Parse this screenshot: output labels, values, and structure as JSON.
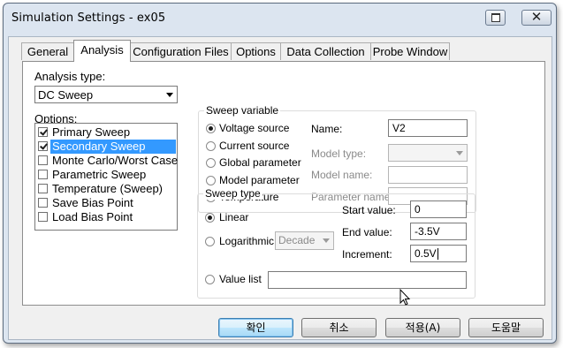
{
  "window": {
    "title": "Simulation Settings - ex05"
  },
  "tabs": [
    "General",
    "Analysis",
    "Configuration Files",
    "Options",
    "Data Collection",
    "Probe Window"
  ],
  "active_tab": "Analysis",
  "analysis": {
    "type_label": "Analysis type:",
    "type_value": "DC Sweep",
    "options_label": "Options:",
    "options": [
      {
        "label": "Primary Sweep",
        "checked": true,
        "selected": false
      },
      {
        "label": "Secondary Sweep",
        "checked": true,
        "selected": true
      },
      {
        "label": "Monte Carlo/Worst Case",
        "checked": false,
        "selected": false
      },
      {
        "label": "Parametric Sweep",
        "checked": false,
        "selected": false
      },
      {
        "label": "Temperature (Sweep)",
        "checked": false,
        "selected": false
      },
      {
        "label": "Save Bias Point",
        "checked": false,
        "selected": false
      },
      {
        "label": "Load Bias Point",
        "checked": false,
        "selected": false
      }
    ]
  },
  "sweep_variable": {
    "title": "Sweep variable",
    "options": [
      "Voltage source",
      "Current source",
      "Global parameter",
      "Model parameter",
      "Temperature"
    ],
    "selected": "Voltage source",
    "name_label": "Name:",
    "name_value": "V2",
    "model_type_label": "Model type:",
    "model_type_value": "",
    "model_name_label": "Model name:",
    "model_name_value": "",
    "parameter_name_label": "Parameter name:",
    "parameter_name_value": ""
  },
  "sweep_type": {
    "title": "Sweep type",
    "linear_label": "Linear",
    "log_label": "Logarithmic",
    "log_scale_value": "Decade",
    "selected": "Linear",
    "start_label": "Start value:",
    "start_value": "0",
    "end_label": "End value:",
    "end_value": "-3.5V",
    "increment_label": "Increment:",
    "increment_value": "0.5V",
    "value_list_label": "Value list",
    "value_list_value": ""
  },
  "buttons": {
    "ok": "확인",
    "cancel": "취소",
    "apply": "적용(A)",
    "help": "도움말"
  }
}
